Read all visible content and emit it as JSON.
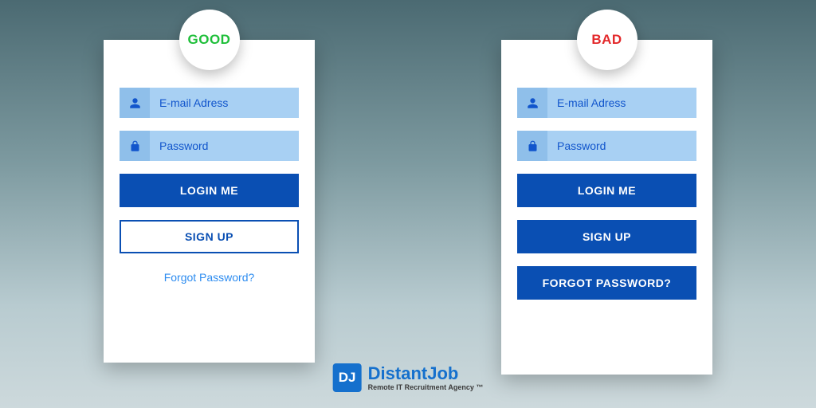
{
  "good": {
    "badge": "GOOD",
    "email_placeholder": "E-mail Adress",
    "password_placeholder": "Password",
    "login_label": "LOGIN ME",
    "signup_label": "SIGN UP",
    "forgot_label": "Forgot Password?"
  },
  "bad": {
    "badge": "BAD",
    "email_placeholder": "E-mail Adress",
    "password_placeholder": "Password",
    "login_label": "LOGIN ME",
    "signup_label": "SIGN UP",
    "forgot_label": "FORGOT PASSWORD?"
  },
  "brand": {
    "logo_text": "DJ",
    "name": "DistantJob",
    "tagline": "Remote IT Recruitment Agency ™"
  },
  "colors": {
    "good": "#1fbf3a",
    "bad": "#e3292b",
    "primary": "#0a4fb3",
    "field": "#a8d0f3",
    "link": "#2d8cf0"
  }
}
